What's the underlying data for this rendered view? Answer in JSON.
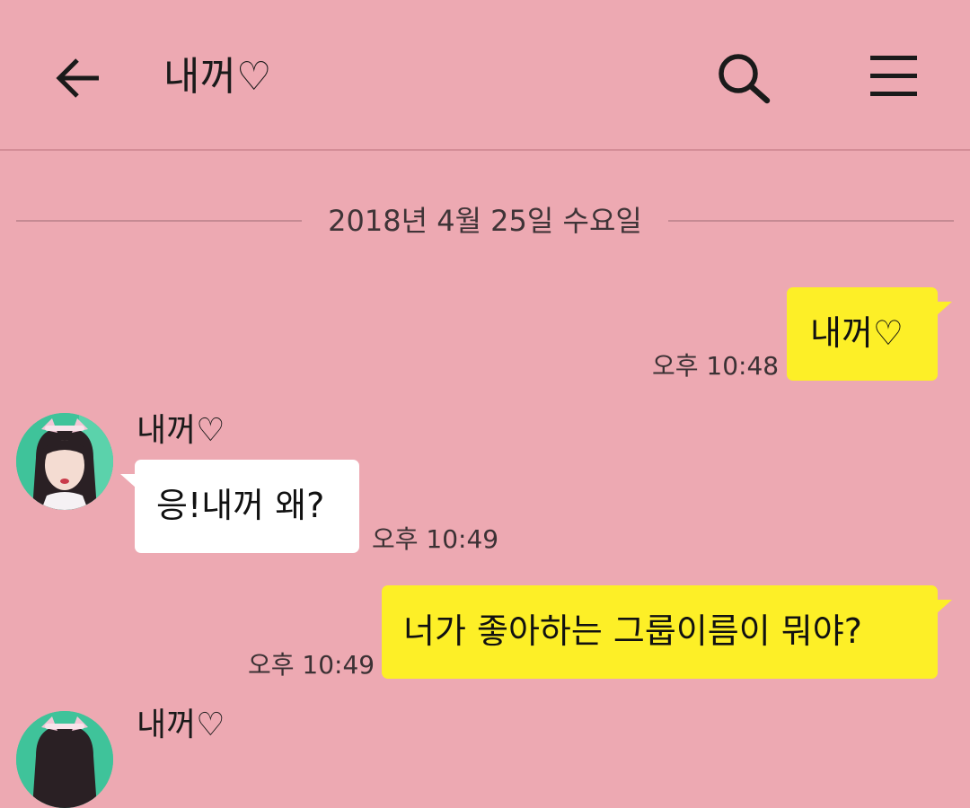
{
  "header": {
    "title": "내꺼♡",
    "back_icon": "arrow-left-icon",
    "search_icon": "search-icon",
    "menu_icon": "hamburger-menu-icon"
  },
  "date_divider": "2018년 4월 25일 수요일",
  "colors": {
    "background": "#eda9b2",
    "my_bubble": "#fdef27",
    "their_bubble": "#ffffff"
  },
  "messages": [
    {
      "from": "me",
      "text": "내꺼♡",
      "time": "오후 10:48"
    },
    {
      "from": "them",
      "sender": "내꺼♡",
      "text": "응!내꺼 왜?",
      "time": "오후 10:49"
    },
    {
      "from": "me",
      "text": "너가 좋아하는 그룹이름이 뭐야?",
      "time": "오후 10:49"
    },
    {
      "from": "them",
      "sender": "내꺼♡"
    }
  ]
}
